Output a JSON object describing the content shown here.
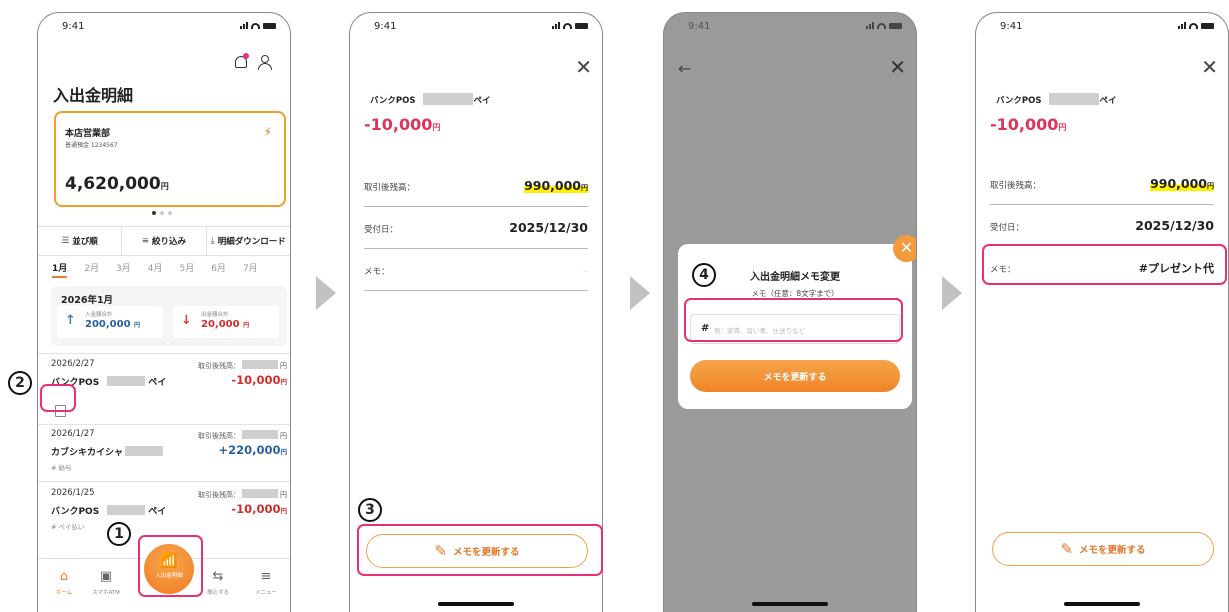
{
  "status": {
    "time": "9:41"
  },
  "screen1": {
    "title": "入出金明細",
    "account": {
      "branch": "本店営業部",
      "number": "普通預金 1234567",
      "balance": "4,620,000",
      "yen": "円"
    },
    "toolbar": {
      "sort": "並び順",
      "filter": "絞り込み",
      "download": "明細ダウンロード"
    },
    "months": [
      "1月",
      "2月",
      "3月",
      "4月",
      "5月",
      "6月",
      "7月"
    ],
    "summary": {
      "month": "2026年1月",
      "deposit_label": "入金額合計",
      "deposit_value": "200,000",
      "withdraw_label": "出金額合計",
      "withdraw_value": "20,000",
      "yen": "円"
    },
    "transactions": [
      {
        "date": "2026/2/27",
        "balance_label": "取引後残高：",
        "name_a": "バンクPOS",
        "name_b": "ペイ",
        "amount": "-10,000",
        "memo": ""
      },
      {
        "date": "2026/1/27",
        "balance_label": "取引後残高：",
        "name_a": "カブシキカイシャ",
        "name_b": "",
        "amount": "+220,000",
        "memo": "# 給与"
      },
      {
        "date": "2026/1/25",
        "balance_label": "取引後残高：",
        "name_a": "バンクPOS",
        "name_b": "ペイ",
        "amount": "-10,000",
        "memo": "# ペイ払い"
      }
    ],
    "yen": "円",
    "tabs": {
      "home": "ホーム",
      "atm": "スマホATM",
      "fab": "入出金明細",
      "transfer": "振込する",
      "menu": "メニュー"
    }
  },
  "detail": {
    "name_a": "バンクPOS",
    "name_b": "ペイ",
    "amount": "-10,000",
    "yen": "円",
    "balance_label": "取引後残高：",
    "balance_value": "990,000",
    "date_label": "受付日：",
    "date_value": "2025/12/30",
    "memo_label": "メモ：",
    "update_button": "メモを更新する"
  },
  "screen4": {
    "memo_value": "#プレゼント代"
  },
  "modal": {
    "title": "入出金明細メモ変更",
    "subtitle": "メモ（任意：8文字まで）",
    "hash": "#",
    "placeholder": "例：家賃、習い事、仕送りなど",
    "submit": "メモを更新する"
  },
  "steps": {
    "s1": "1",
    "s2": "2",
    "s3": "3",
    "s4": "4"
  },
  "colors": {
    "accent": "#f07828",
    "highlight": "#e8307a",
    "negative": "#d12d2d",
    "positive": "#2a5fa8"
  }
}
